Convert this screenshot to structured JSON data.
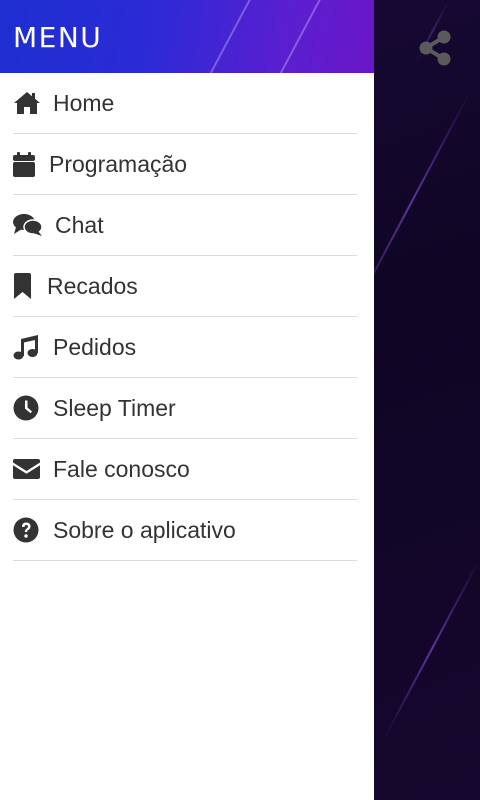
{
  "drawer": {
    "title": "MENU",
    "items": [
      {
        "label": "Home",
        "icon": "home-icon"
      },
      {
        "label": "Programação",
        "icon": "calendar-icon"
      },
      {
        "label": "Chat",
        "icon": "chat-icon"
      },
      {
        "label": "Recados",
        "icon": "bookmark-icon"
      },
      {
        "label": "Pedidos",
        "icon": "music-note-icon"
      },
      {
        "label": "Sleep Timer",
        "icon": "clock-icon"
      },
      {
        "label": "Fale conosco",
        "icon": "envelope-icon"
      },
      {
        "label": "Sobre o aplicativo",
        "icon": "question-circle-icon"
      }
    ]
  },
  "toolbar": {
    "share_icon": "share-icon"
  },
  "colors": {
    "header_start": "#1e2fd0",
    "header_end": "#6a17c8",
    "background": "#0f0524",
    "icon": "#333333",
    "text": "#333333",
    "divider": "#dcdcdc"
  }
}
